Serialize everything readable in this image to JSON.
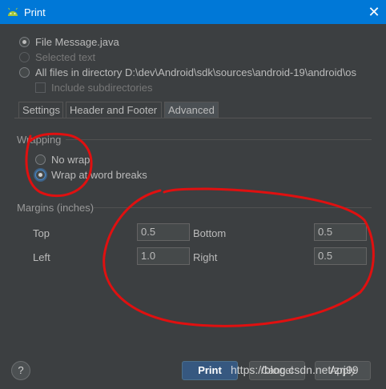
{
  "window": {
    "title": "Print",
    "icon": "android-icon",
    "close_glyph": "✕"
  },
  "scope": {
    "options": [
      {
        "label": "File Message.java",
        "selected": true,
        "disabled": false
      },
      {
        "label": "Selected text",
        "selected": false,
        "disabled": true
      },
      {
        "label": "All files in directory D:\\dev\\Android\\sdk\\sources\\android-19\\android\\os",
        "selected": false,
        "disabled": false
      }
    ],
    "include_subdirectories": {
      "label": "Include subdirectories",
      "checked": false,
      "disabled": true
    }
  },
  "tabs": [
    {
      "label": "Settings",
      "active": false
    },
    {
      "label": "Header and Footer",
      "active": false
    },
    {
      "label": "Advanced",
      "active": true
    }
  ],
  "wrapping": {
    "title": "Wrapping",
    "options": [
      {
        "label": "No wrap",
        "selected": false
      },
      {
        "label": "Wrap at word breaks",
        "selected": true
      }
    ]
  },
  "margins": {
    "title": "Margins (inches)",
    "top": {
      "label": "Top",
      "value": "0.5"
    },
    "bottom": {
      "label": "Bottom",
      "value": "0.5"
    },
    "left": {
      "label": "Left",
      "value": "1.0"
    },
    "right": {
      "label": "Right",
      "value": "0.5"
    }
  },
  "buttons": {
    "help": "?",
    "print": "Print",
    "cancel": "Cancel",
    "apply": "Apply"
  },
  "watermark": "https://blog.csdn.net/zrj99",
  "colors": {
    "titlebar": "#0078d7",
    "background": "#3c3f41",
    "primary_button": "#365880",
    "annotation": "#e01010"
  }
}
